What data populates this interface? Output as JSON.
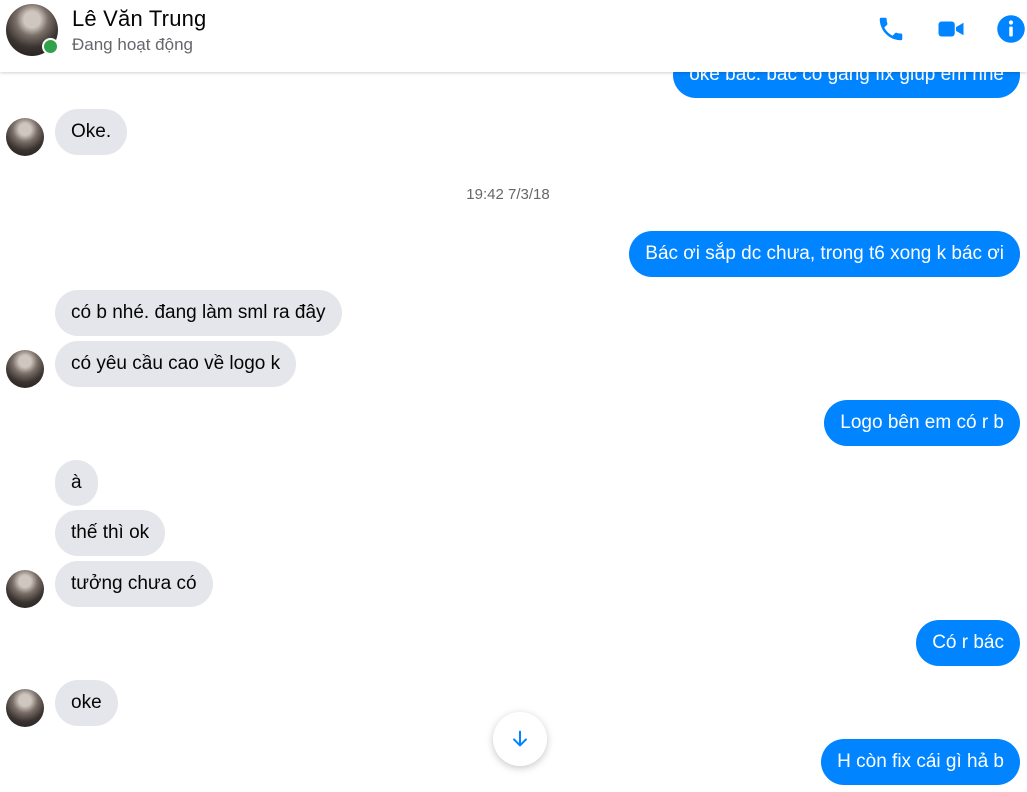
{
  "header": {
    "contact_name": "Lê Văn Trung",
    "status": "Đang hoạt động",
    "online": true,
    "accent_color": "#0084ff",
    "online_color": "#31a24c",
    "actions": [
      {
        "name": "phone-icon"
      },
      {
        "name": "video-icon"
      },
      {
        "name": "info-icon"
      }
    ]
  },
  "timestamp": "19:42 7/3/18",
  "messages": {
    "m0": "oke bác. bác cố gắng fix giúp em nhé",
    "m1": "Oke.",
    "m2": "Bác ơi sắp dc chưa, trong t6 xong k bác ơi",
    "m3": "có b nhé. đang làm sml ra đây",
    "m4": "có yêu cầu cao về logo k",
    "m5": "Logo bên em có r b",
    "m6": "à",
    "m7": "thế thì ok",
    "m8": "tưởng chưa có",
    "m9": "Có r bác",
    "m10": "oke",
    "m11": "H còn fix cái gì hả b"
  },
  "colors": {
    "outgoing_bubble": "#0084ff",
    "incoming_bubble": "#e4e6eb"
  }
}
